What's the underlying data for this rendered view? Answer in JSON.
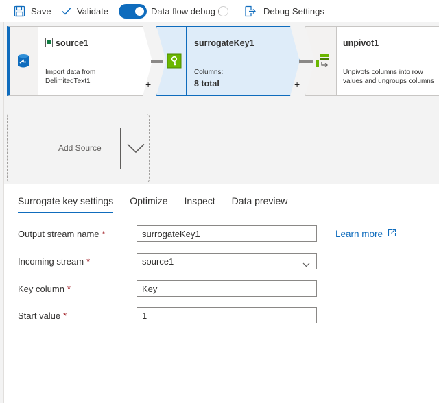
{
  "toolbar": {
    "save_label": "Save",
    "validate_label": "Validate",
    "debug_label": "Data flow debug",
    "debug_on": true,
    "debug_settings_label": "Debug Settings"
  },
  "nodes": [
    {
      "title": "source1",
      "desc_line1": "Import data from",
      "desc_line2": "DelimitedText1",
      "icon": "source-database-icon"
    },
    {
      "title": "surrogateKey1",
      "desc_line1": "Columns:",
      "desc_line2": "8 total",
      "icon": "surrogate-key-icon",
      "selected": true
    },
    {
      "title": "unpivot1",
      "desc_line1": "Unpivots columns into row",
      "desc_line2": "values and ungroups columns",
      "icon": "unpivot-icon"
    }
  ],
  "plus_symbol": "+",
  "add_source_label": "Add Source",
  "tabs": [
    {
      "label": "Surrogate key settings",
      "active": true
    },
    {
      "label": "Optimize"
    },
    {
      "label": "Inspect"
    },
    {
      "label": "Data preview"
    }
  ],
  "form": {
    "required_mark": "*",
    "output_stream": {
      "label": "Output stream name",
      "value": "surrogateKey1"
    },
    "incoming_stream": {
      "label": "Incoming stream",
      "value": "source1"
    },
    "key_column": {
      "label": "Key column",
      "value": "Key"
    },
    "start_value": {
      "label": "Start value",
      "value": "1"
    },
    "learn_more": "Learn more"
  },
  "colors": {
    "accent": "#0f6cbd",
    "selected_fill": "#deecf9",
    "required": "#a4262c"
  }
}
